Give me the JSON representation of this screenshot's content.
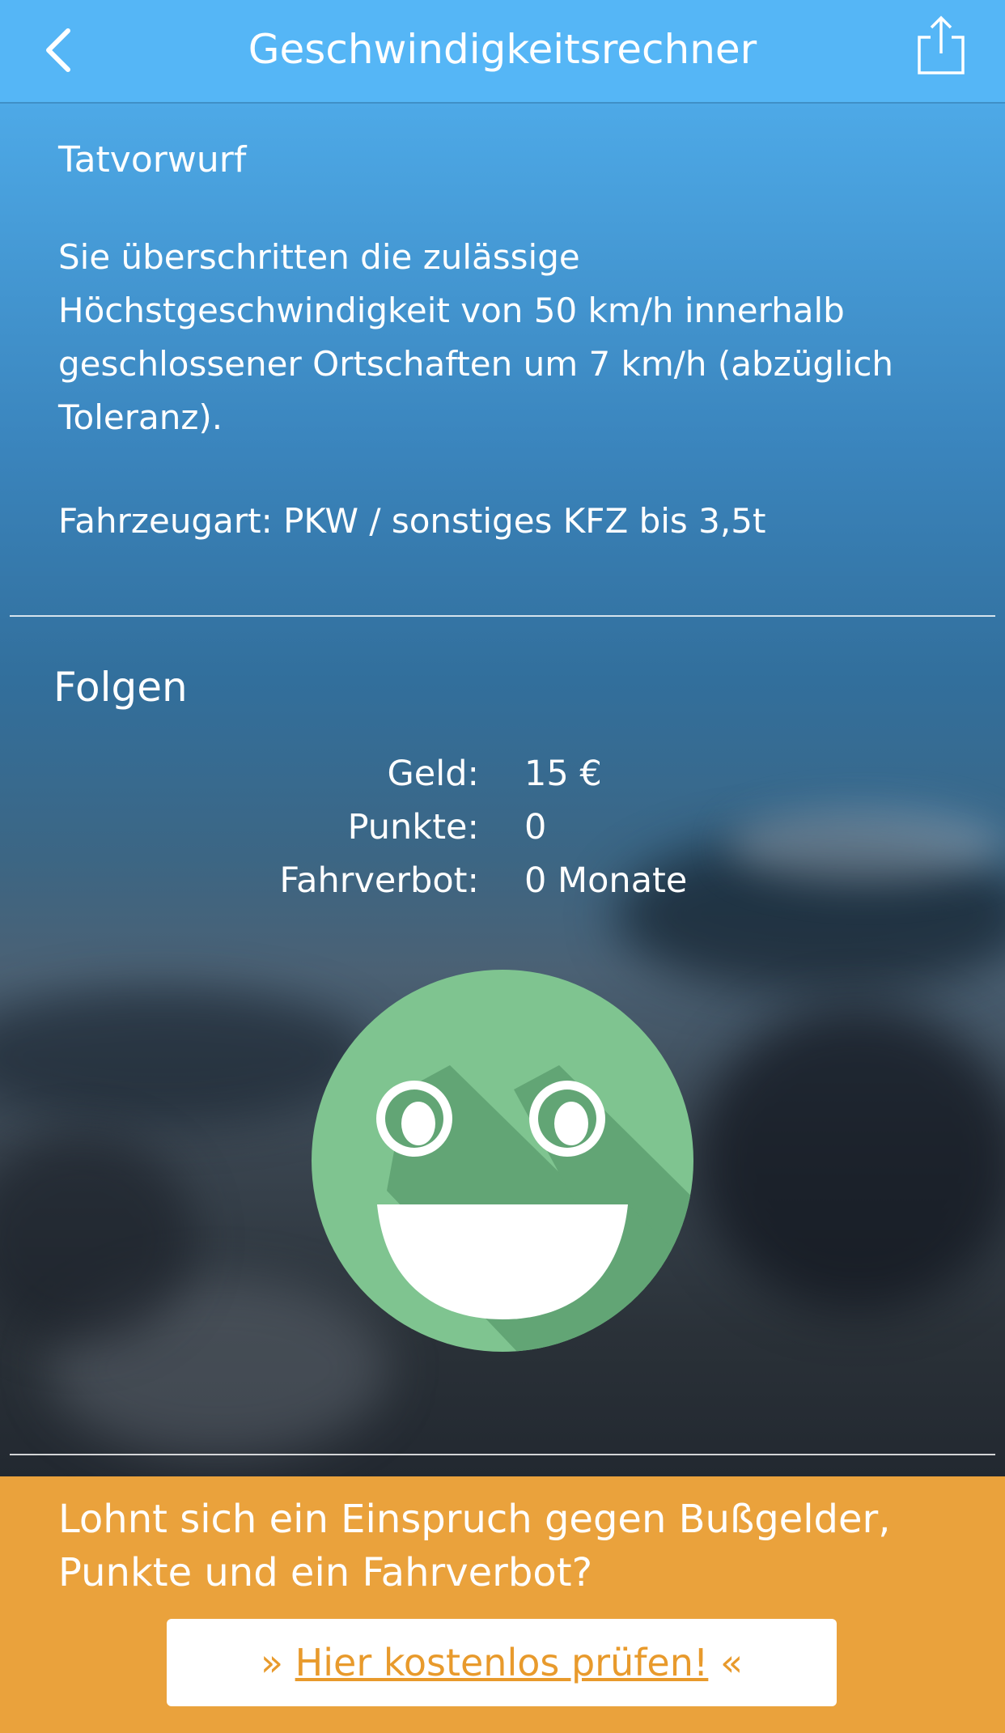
{
  "nav": {
    "title": "Geschwindigkeitsrechner",
    "back_icon": "chevron-left-icon",
    "share_icon": "share-icon"
  },
  "offense": {
    "label": "Tatvorwurf",
    "description": "Sie überschritten die zulässige Höchstgeschwindigkeit von 50 km/h innerhalb geschlossener Ortschaften um 7 km/h (abzüglich Toleranz).",
    "vehicle": "Fahrzeugart: PKW / sonstiges KFZ bis 3,5t"
  },
  "consequences": {
    "heading": "Folgen",
    "rows": [
      {
        "label": "Geld:",
        "value": "15 €"
      },
      {
        "label": "Punkte:",
        "value": "0"
      },
      {
        "label": "Fahrverbot:",
        "value": "0 Monate"
      }
    ],
    "indicator_icon": "happy-face-icon"
  },
  "promo": {
    "text": "Lohnt sich ein Einspruch gegen Bußgelder, Punkte und ein Fahrverbot?",
    "cta_prefix": "» ",
    "cta_link": "Hier kostenlos prüfen!",
    "cta_suffix": " «"
  },
  "colors": {
    "navbar": "#55b6f6",
    "promo": "#eaa23c",
    "smiley": "#7fc490",
    "smiley_shadow": "#62a575",
    "cta_text": "#e89a2c"
  }
}
